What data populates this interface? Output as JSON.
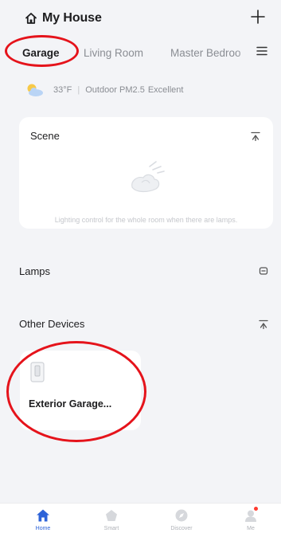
{
  "header": {
    "title": "My House",
    "add_icon": "plus-icon",
    "home_icon": "house-icon"
  },
  "rooms": {
    "tabs": [
      {
        "label": "Garage",
        "active": true
      },
      {
        "label": "Living Room",
        "active": false
      },
      {
        "label": "Master Bedroo",
        "active": false
      }
    ],
    "menu_icon": "room-menu-icon"
  },
  "weather": {
    "icon": "partly-cloudy-icon",
    "temperature": "33°F",
    "air_label": "Outdoor PM2.5",
    "air_quality": "Excellent"
  },
  "scene": {
    "title": "Scene",
    "empty_hint": "Lighting control for the whole room when there are lamps.",
    "collapse_icon": "collapse-icon"
  },
  "lamps": {
    "title": "Lamps",
    "icon": "lamp-toggle-icon"
  },
  "other_devices": {
    "title": "Other Devices",
    "collapse_icon": "collapse-icon",
    "devices": [
      {
        "name": "Exterior Garage...",
        "icon": "switch-device-icon"
      }
    ]
  },
  "bottom_nav": {
    "items": [
      {
        "label": "Home",
        "icon": "home-icon",
        "active": true
      },
      {
        "label": "Smart",
        "icon": "smart-icon",
        "active": false
      },
      {
        "label": "Discover",
        "icon": "discover-icon",
        "active": false
      },
      {
        "label": "Me",
        "icon": "me-icon",
        "active": false
      }
    ]
  },
  "colors": {
    "accent": "#2d63d8",
    "annotation": "#e5131b",
    "background": "#f3f4f7",
    "card": "#ffffff"
  }
}
